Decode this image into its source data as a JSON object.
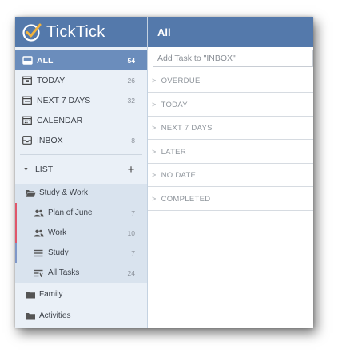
{
  "brand": {
    "name": "TickTick"
  },
  "header": {
    "title": "All"
  },
  "add_task": {
    "placeholder": "Add Task to \"INBOX\""
  },
  "nav": [
    {
      "id": "all",
      "label": "ALL",
      "count": "54",
      "icon": "tray-icon",
      "active": true
    },
    {
      "id": "today",
      "label": "TODAY",
      "count": "26",
      "icon": "today-calendar-icon"
    },
    {
      "id": "next7",
      "label": "NEXT 7 DAYS",
      "count": "32",
      "icon": "week-calendar-icon"
    },
    {
      "id": "calendar",
      "label": "CALENDAR",
      "count": "",
      "icon": "calendar-icon"
    },
    {
      "id": "inbox",
      "label": "INBOX",
      "count": "8",
      "icon": "inbox-icon"
    }
  ],
  "list_section": {
    "label": "LIST",
    "add_symbol": "+"
  },
  "folders": [
    {
      "label": "Study & Work",
      "icon": "folder-open-icon",
      "lists": [
        {
          "label": "Plan of June",
          "count": "7",
          "icon": "shared-users-icon",
          "marker_color": "#e0566a"
        },
        {
          "label": "Work",
          "count": "10",
          "icon": "shared-users-icon",
          "marker_color": "#e0566a"
        },
        {
          "label": "Study",
          "count": "7",
          "icon": "list-lines-icon",
          "marker_color": "#7f97c8"
        },
        {
          "label": "All Tasks",
          "count": "24",
          "icon": "all-tasks-icon",
          "marker_color": ""
        }
      ]
    },
    {
      "label": "Family",
      "icon": "folder-icon",
      "lists": []
    },
    {
      "label": "Activities",
      "icon": "folder-icon",
      "lists": []
    }
  ],
  "sections": [
    {
      "label": "OVERDUE"
    },
    {
      "label": "TODAY"
    },
    {
      "label": "NEXT 7 DAYS"
    },
    {
      "label": "LATER"
    },
    {
      "label": "NO DATE"
    },
    {
      "label": "COMPLETED"
    }
  ],
  "colors": {
    "header_blue": "#5479ab",
    "active_row": "#6b8dbc",
    "sidebar_bg": "#eaf0f7",
    "folder_bg": "#d9e3ee",
    "brand_check": "#f2b33d"
  }
}
